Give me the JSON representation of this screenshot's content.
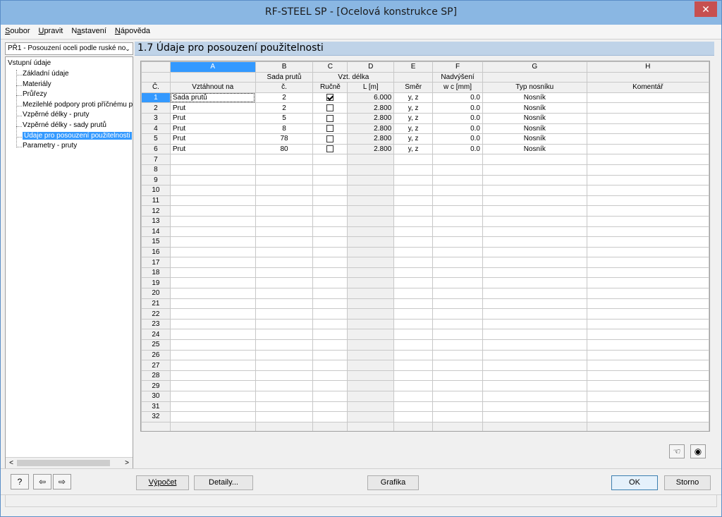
{
  "window": {
    "title": "RF-STEEL SP - [Ocelová konstrukce SP]",
    "close": "✕"
  },
  "menu": [
    {
      "label": "Soubor",
      "u": "S"
    },
    {
      "label": "Upravit",
      "u": "U"
    },
    {
      "label": "Nastavení",
      "u": "a"
    },
    {
      "label": "Nápověda",
      "u": "N"
    }
  ],
  "module_case": "PŘ1 - Posouzení oceli podle ruské no",
  "tree": {
    "root": "Vstupní údaje",
    "items": [
      "Základní údaje",
      "Materiály",
      "Průřezy",
      "Mezilehlé podpory proti příčnému po",
      "Vzpěrné délky - pruty",
      "Vzpěrné délky - sady prutů",
      "Údaje pro posouzení použitelnosti",
      "Parametry - pruty"
    ],
    "selected_index": 6
  },
  "section_title": "1.7 Údaje pro posouzení použitelnosti",
  "table": {
    "col_letters": [
      "A",
      "B",
      "C",
      "D",
      "E",
      "F",
      "G",
      "H"
    ],
    "header_row1": {
      "no": "",
      "a": "",
      "b": "Sada prutů",
      "cd": "Vzt. délka",
      "e": "",
      "f": "Nadvýšení",
      "g": "",
      "h": ""
    },
    "header_row2": {
      "no": "Č.",
      "a": "Vztáhnout na",
      "b": "č.",
      "c": "Ručně",
      "d": "L [m]",
      "e": "Směr",
      "f": "w c [mm]",
      "g": "Typ nosníku",
      "h": "Komentář"
    },
    "rows": [
      {
        "no": "1",
        "a": "Sada prutů",
        "b": "2",
        "c": true,
        "d": "6.000",
        "e": "y, z",
        "f": "0.0",
        "g": "Nosník",
        "h": ""
      },
      {
        "no": "2",
        "a": "Prut",
        "b": "2",
        "c": false,
        "d": "2.800",
        "e": "y, z",
        "f": "0.0",
        "g": "Nosník",
        "h": ""
      },
      {
        "no": "3",
        "a": "Prut",
        "b": "5",
        "c": false,
        "d": "2.800",
        "e": "y, z",
        "f": "0.0",
        "g": "Nosník",
        "h": ""
      },
      {
        "no": "4",
        "a": "Prut",
        "b": "8",
        "c": false,
        "d": "2.800",
        "e": "y, z",
        "f": "0.0",
        "g": "Nosník",
        "h": ""
      },
      {
        "no": "5",
        "a": "Prut",
        "b": "78",
        "c": false,
        "d": "2.800",
        "e": "y, z",
        "f": "0.0",
        "g": "Nosník",
        "h": ""
      },
      {
        "no": "6",
        "a": "Prut",
        "b": "80",
        "c": false,
        "d": "2.800",
        "e": "y, z",
        "f": "0.0",
        "g": "Nosník",
        "h": ""
      }
    ],
    "empty_row_numbers": [
      "7",
      "8",
      "9",
      "10",
      "11",
      "12",
      "13",
      "14",
      "15",
      "16",
      "17",
      "18",
      "19",
      "20",
      "21",
      "22",
      "23",
      "24",
      "25",
      "26",
      "27",
      "28",
      "29",
      "30",
      "31",
      "32"
    ]
  },
  "icons": {
    "pick": "pointer-pick-icon",
    "view": "eye-icon",
    "help": "help-icon",
    "import": "import-icon",
    "export": "export-icon"
  },
  "buttons": {
    "vypocet": "Výpočet",
    "detaily": "Detaily...",
    "grafika": "Grafika",
    "ok": "OK",
    "storno": "Storno"
  },
  "colors": {
    "accent": "#3399ff",
    "titlebar": "#8ab7e3",
    "section": "#bfd3e8"
  }
}
